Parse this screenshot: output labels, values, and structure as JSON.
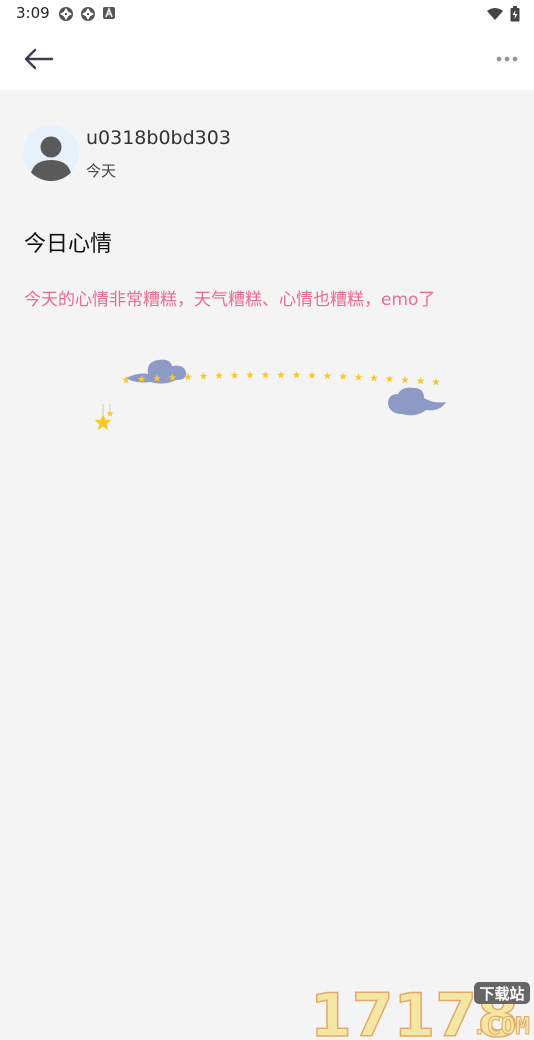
{
  "status_bar": {
    "time": "3:09",
    "icons_left": [
      "aperture-icon",
      "aperture-icon",
      "a-badge-icon"
    ],
    "icons_right": [
      "wifi-icon",
      "battery-icon"
    ]
  },
  "app_bar": {
    "back_icon": "arrow-left-icon",
    "more_icon": "more-horizontal-icon"
  },
  "post": {
    "author": "u0318b0bd303",
    "date": "今天",
    "title": "今日心情",
    "body": "今天的心情非常糟糕，天气糟糕、心情也糟糕，emo了"
  },
  "colors": {
    "body_text": "#ec6a8c",
    "star": "#f7c82a",
    "moon": "#f9cf1c",
    "cloud": "#8d9ac6"
  },
  "watermark": {
    "digits": "17178",
    "badge": "下载站",
    "suffix": ".COM"
  }
}
